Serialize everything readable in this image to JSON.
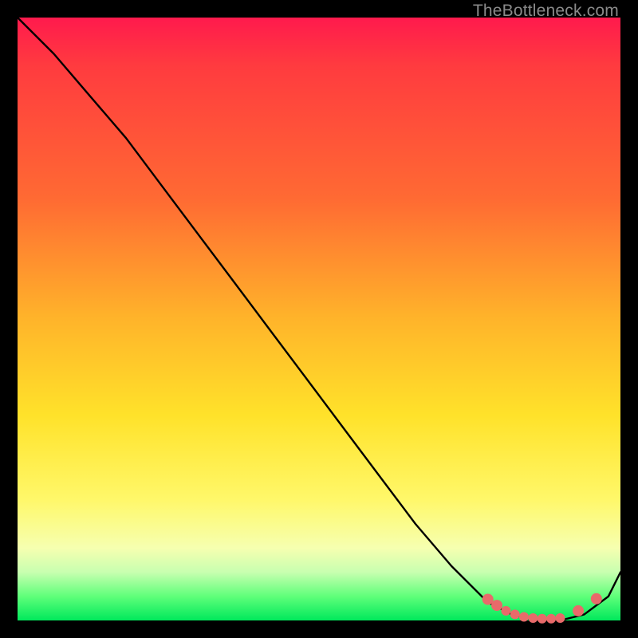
{
  "watermark": "TheBottleneck.com",
  "chart_data": {
    "type": "line",
    "title": "",
    "xlabel": "",
    "ylabel": "",
    "ylim": [
      0,
      100
    ],
    "xlim": [
      0,
      100
    ],
    "series": [
      {
        "name": "bottleneck-curve",
        "x": [
          0,
          6,
          12,
          18,
          24,
          30,
          36,
          42,
          48,
          54,
          60,
          66,
          72,
          78,
          82,
          86,
          90,
          94,
          98,
          100
        ],
        "y": [
          100,
          94,
          87,
          80,
          72,
          64,
          56,
          48,
          40,
          32,
          24,
          16,
          9,
          3,
          1,
          0,
          0,
          1,
          4,
          8
        ]
      }
    ],
    "markers": {
      "name": "optimal-range-dots",
      "x": [
        78,
        79.5,
        81,
        82.5,
        84,
        85.5,
        87,
        88.5,
        90,
        93,
        96
      ],
      "y": [
        3.5,
        2.5,
        1.6,
        1.0,
        0.6,
        0.4,
        0.3,
        0.3,
        0.4,
        1.6,
        3.6
      ]
    },
    "colors": {
      "curve": "#000000",
      "markers": "#e86a6a"
    }
  }
}
